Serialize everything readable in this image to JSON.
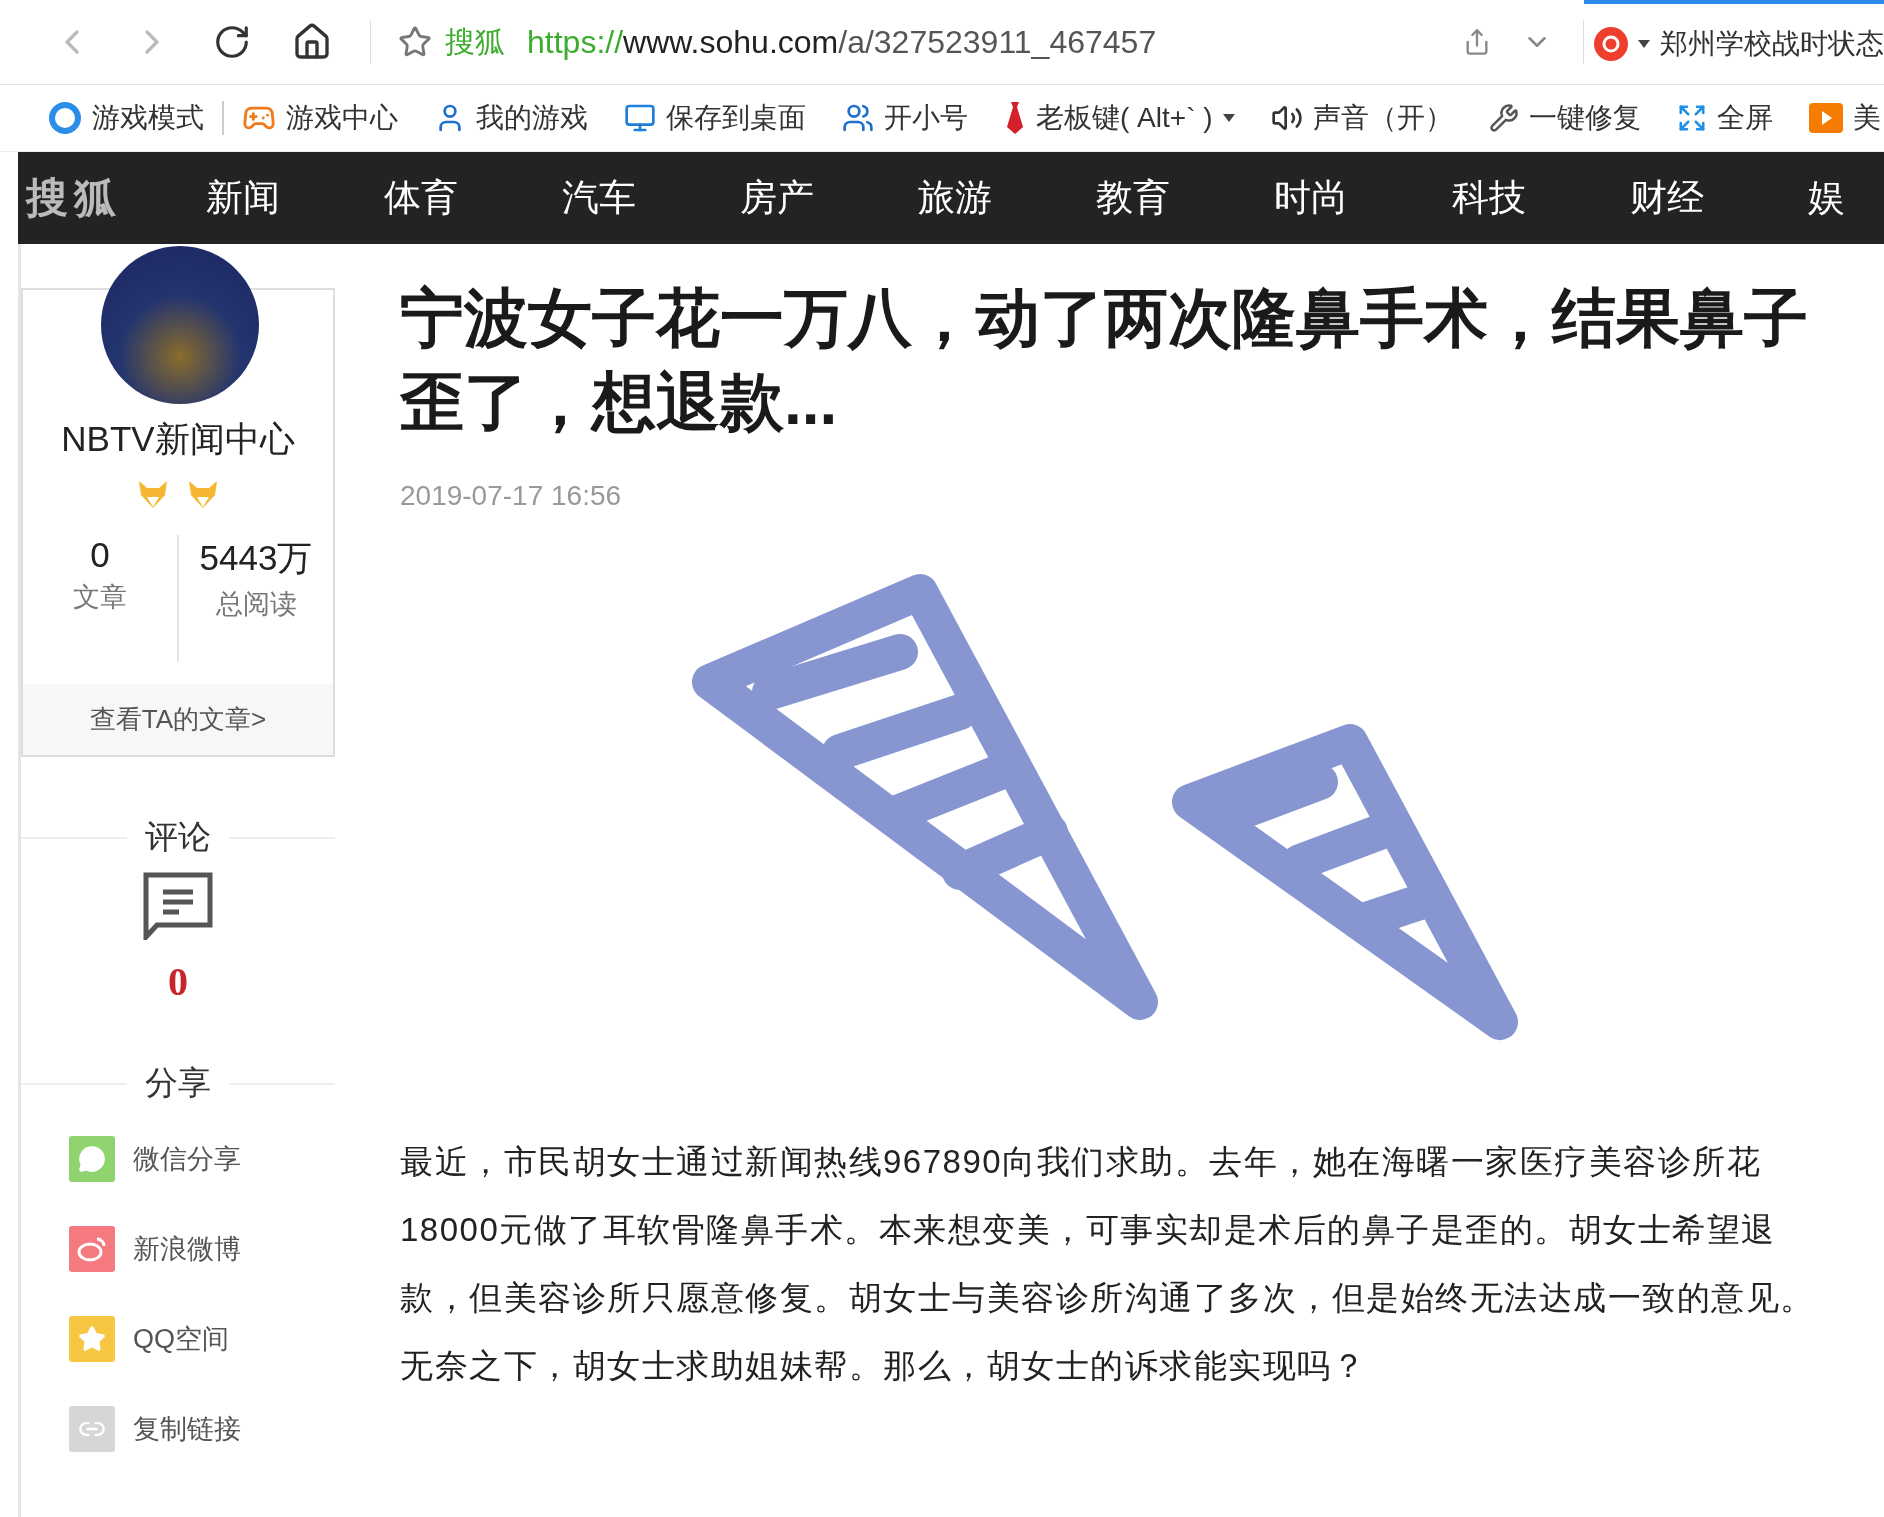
{
  "toolbar": {
    "site_label": "搜狐",
    "url_scheme": "https://",
    "url_host": "www.sohu.com",
    "url_path": "/a/327523911_467457",
    "search_text": "郑州学校战时状态"
  },
  "bookmarks": [
    {
      "label": "游戏模式",
      "kind": "game-mode"
    },
    {
      "label": "游戏中心",
      "kind": "gamepad"
    },
    {
      "label": "我的游戏",
      "kind": "user"
    },
    {
      "label": "保存到桌面",
      "kind": "monitor"
    },
    {
      "label": "开小号",
      "kind": "users"
    },
    {
      "label": "老板键( Alt+` )",
      "kind": "tie"
    },
    {
      "label": "声音（开）",
      "kind": "sound"
    },
    {
      "label": "一键修复",
      "kind": "wrench"
    },
    {
      "label": "全屏",
      "kind": "fullscreen"
    },
    {
      "label": "美",
      "kind": "play"
    }
  ],
  "nav": {
    "logo": "搜狐",
    "items": [
      "新闻",
      "体育",
      "汽车",
      "房产",
      "旅游",
      "教育",
      "时尚",
      "科技",
      "财经",
      "娱"
    ]
  },
  "author": {
    "name": "NBTV新闻中心",
    "stats": [
      {
        "value": "0",
        "label": "文章"
      },
      {
        "value": "5443万",
        "label": "总阅读"
      }
    ],
    "link": "查看TA的文章>"
  },
  "comments": {
    "heading": "评论",
    "count": "0"
  },
  "share": {
    "heading": "分享",
    "items": [
      {
        "label": "微信分享",
        "kind": "wechat"
      },
      {
        "label": "新浪微博",
        "kind": "weibo"
      },
      {
        "label": "QQ空间",
        "kind": "qzone"
      },
      {
        "label": "复制链接",
        "kind": "link"
      }
    ]
  },
  "article": {
    "title": "宁波女子花一万八，动了两次隆鼻手术，结果鼻子歪了，想退款...",
    "date": "2019-07-17 16:56",
    "paragraph": "最近，市民胡女士通过新闻热线967890向我们求助。去年，她在海曙一家医疗美容诊所花18000元做了耳软骨隆鼻手术。本来想变美，可事实却是术后的鼻子是歪的。胡女士希望退款，但美容诊所只愿意修复。胡女士与美容诊所沟通了多次，但是始终无法达成一致的意见。无奈之下，胡女士求助姐妹帮。那么，胡女士的诉求能实现吗？"
  }
}
